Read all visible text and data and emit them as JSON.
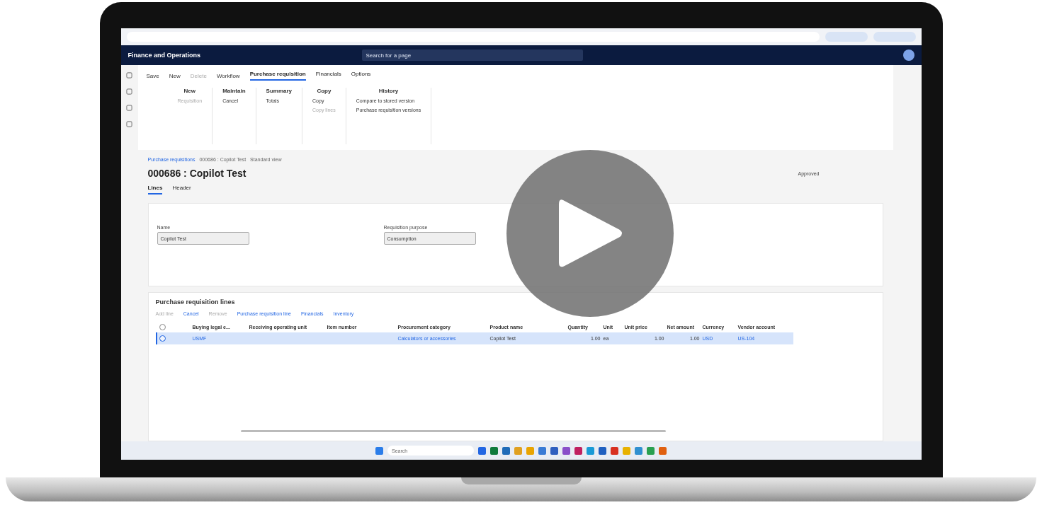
{
  "app_bar": {
    "title": "Finance and Operations",
    "search_placeholder": "Search for a page"
  },
  "action_pane": {
    "buttons": [
      {
        "label": "Save",
        "disabled": false
      },
      {
        "label": "New",
        "disabled": false
      },
      {
        "label": "Delete",
        "disabled": true
      },
      {
        "label": "Workflow",
        "disabled": false
      }
    ],
    "tabs": [
      {
        "label": "Purchase requisition",
        "selected": true
      },
      {
        "label": "Financials",
        "selected": false
      },
      {
        "label": "Options",
        "selected": false
      }
    ],
    "groups": [
      {
        "title": "New",
        "items": [
          {
            "label": "Requisition",
            "disabled": true
          }
        ]
      },
      {
        "title": "Maintain",
        "items": [
          {
            "label": "Cancel",
            "disabled": false
          }
        ]
      },
      {
        "title": "Summary",
        "items": [
          {
            "label": "Totals",
            "disabled": false
          }
        ]
      },
      {
        "title": "Copy",
        "items": [
          {
            "label": "Copy",
            "disabled": false
          },
          {
            "label": "Copy lines",
            "disabled": true
          }
        ]
      },
      {
        "title": "History",
        "items": [
          {
            "label": "Compare to stored version",
            "disabled": false
          },
          {
            "label": "Purchase requisition versions",
            "disabled": false
          }
        ]
      }
    ]
  },
  "breadcrumb": [
    "Purchase requisitions",
    "000686 : Copilot Test",
    "Standard view"
  ],
  "title": "000686 : Copilot Test",
  "status": "Approved",
  "view_tabs": [
    {
      "label": "Lines",
      "selected": true
    },
    {
      "label": "Header",
      "selected": false
    }
  ],
  "fields": [
    {
      "label": "Name",
      "value": "Copilot Test"
    },
    {
      "label": "Requisition purpose",
      "value": "Consumption"
    }
  ],
  "lines": {
    "title": "Purchase requisition lines",
    "select_all": false,
    "toolbar": [
      {
        "label": "Add line",
        "disabled": true
      },
      {
        "label": "Cancel",
        "disabled": false
      },
      {
        "label": "Remove",
        "disabled": true
      },
      {
        "label": "Purchase requisition line",
        "disabled": false
      },
      {
        "label": "Financials",
        "disabled": false
      },
      {
        "label": "Inventory",
        "disabled": false
      }
    ],
    "columns": [
      "Buying legal e...",
      "Receiving operating unit",
      "Item number",
      "Procurement category",
      "Product name",
      "Quantity",
      "Unit",
      "Unit price",
      "Net amount",
      "Currency",
      "Vendor account"
    ],
    "rows": [
      {
        "selected": true,
        "cells": [
          "USMF",
          "",
          "",
          "Calculators or accessories",
          "Copilot Test",
          "1.00",
          "ea",
          "1.00",
          "1.00",
          "USD",
          "US-104"
        ]
      }
    ]
  },
  "taskbar": {
    "search_placeholder": "Search"
  }
}
